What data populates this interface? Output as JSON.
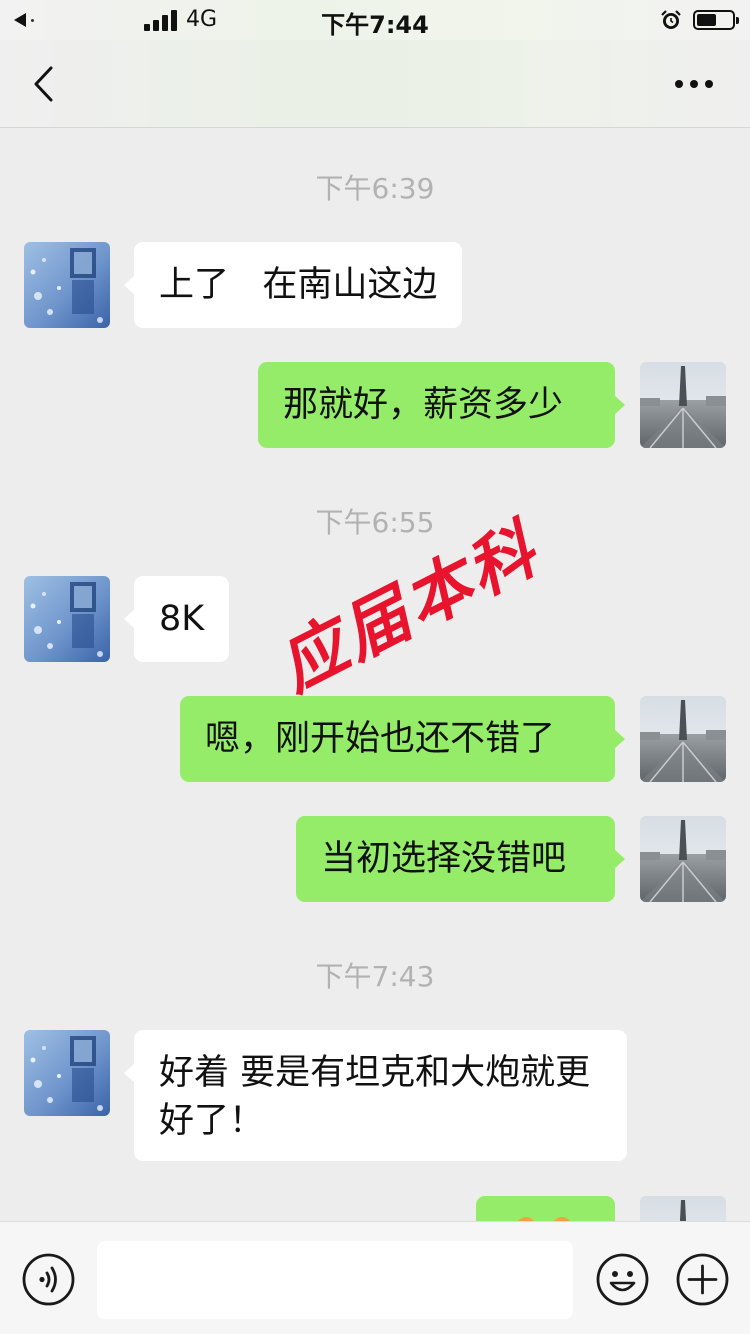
{
  "status_bar": {
    "carrier_back_icon": "back-to-app-icon",
    "network": "4G",
    "time": "下午7:44",
    "alarm_icon": "alarm-icon",
    "battery_level": 0.55
  },
  "nav": {
    "back_icon": "chevron-left-icon",
    "more_icon": "more-dots-icon"
  },
  "chat": {
    "timestamps": [
      "下午6:39",
      "下午6:55",
      "下午7:43"
    ],
    "messages": [
      {
        "side": "in",
        "text": "上了   在南山这边"
      },
      {
        "side": "out",
        "text": "那就好，薪资多少"
      },
      {
        "side": "in",
        "text": "8K"
      },
      {
        "side": "out",
        "text": "嗯，刚开始也还不错了"
      },
      {
        "side": "out",
        "text": "当初选择没错吧"
      },
      {
        "side": "in",
        "text": "好着  要是有坦克和大炮就更好了！"
      },
      {
        "side": "out",
        "text": ""
      }
    ],
    "colors": {
      "background": "#ededed",
      "incoming_bubble": "#ffffff",
      "outgoing_bubble": "#95ec69",
      "timestamp": "#b2b2b2",
      "watermark": "#e8132c"
    }
  },
  "watermark": "应届本科",
  "input_bar": {
    "voice_icon": "voice-icon",
    "input_value": "",
    "emoji_icon": "emoji-icon",
    "plus_icon": "plus-icon"
  }
}
